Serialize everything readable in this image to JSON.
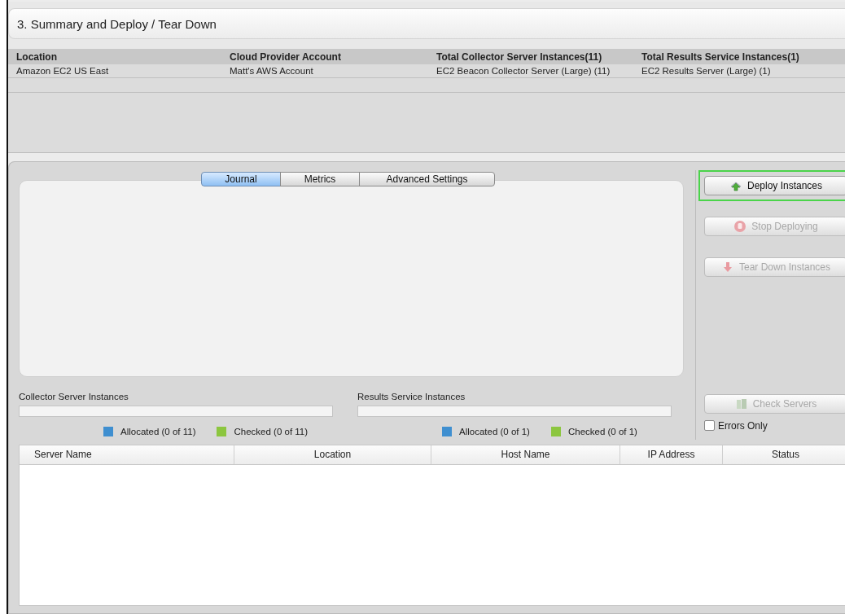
{
  "header": {
    "title": "3. Summary and Deploy / Tear Down"
  },
  "summary": {
    "columns": [
      "Location",
      "Cloud Provider Account",
      "Total Collector Server Instances(11)",
      "Total Results Service Instances(1)"
    ],
    "rows": [
      [
        "Amazon EC2 US East",
        "Matt's AWS Account",
        "EC2 Beacon Collector Server (Large) (11)",
        "EC2 Results Server (Large) (1)"
      ]
    ]
  },
  "tabs": [
    {
      "label": "Journal",
      "selected": true
    },
    {
      "label": "Metrics",
      "selected": false
    },
    {
      "label": "Advanced Settings",
      "selected": false
    }
  ],
  "actions": [
    {
      "label": "Deploy Instances",
      "kind": "deploy",
      "disabled": false,
      "focused": true
    },
    {
      "label": "Stop Deploying",
      "kind": "stop",
      "disabled": true,
      "focused": false
    },
    {
      "label": "Tear Down Instances",
      "kind": "teardown",
      "disabled": true,
      "focused": false
    }
  ],
  "progress": [
    {
      "title": "Collector Server Instances",
      "level": 0,
      "legend": [
        {
          "label": "Allocated (0 of 11)",
          "color": "#3f8fd0"
        },
        {
          "label": "Checked (0 of 11)",
          "color": "#8cc63f"
        }
      ]
    },
    {
      "title": "Results Service Instances",
      "level": 0,
      "legend": [
        {
          "label": "Allocated (0 of 1)",
          "color": "#3f8fd0"
        },
        {
          "label": "Checked (0 of 1)",
          "color": "#8cc63f"
        }
      ]
    }
  ],
  "check_button": {
    "label": "Check Servers",
    "disabled": true
  },
  "errors_only": {
    "label": "Errors Only",
    "checked": false
  },
  "servers": {
    "columns": [
      "Server Name",
      "Location",
      "Host Name",
      "IP Address",
      "Status"
    ]
  }
}
